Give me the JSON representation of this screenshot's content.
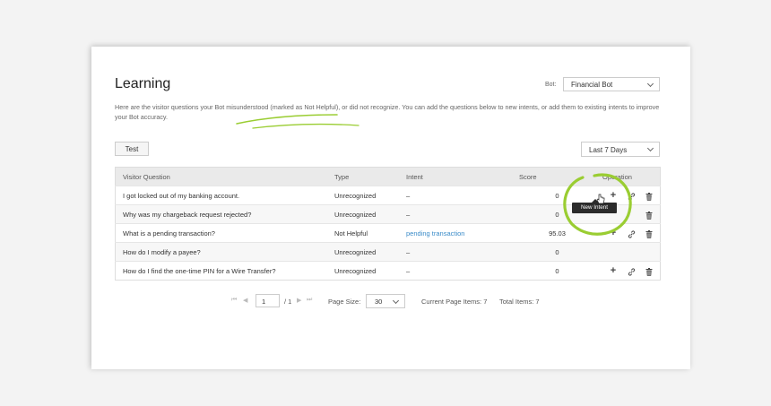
{
  "page": {
    "title": "Learning",
    "bot_label": "Bot:",
    "bot_value": "Financial Bot",
    "description": "Here are the visitor questions your Bot misunderstood (marked as Not Helpful), or did not recognize. You can add the questions below to new intents, or add them to existing intents to improve your Bot accuracy.",
    "test_label": "Test",
    "range_value": "Last 7 Days"
  },
  "table": {
    "headers": {
      "question": "Visitor Question",
      "type": "Type",
      "intent": "Intent",
      "score": "Score",
      "operation": "Operation"
    },
    "rows": [
      {
        "question": "I got locked out of my banking account.",
        "type": "Unrecognized",
        "intent": "–",
        "score": "0"
      },
      {
        "question": "Why was my chargeback request rejected?",
        "type": "Unrecognized",
        "intent": "–",
        "score": "0"
      },
      {
        "question": "What is a pending transaction?",
        "type": "Not Helpful",
        "intent": "pending transaction",
        "score": "95.03"
      },
      {
        "question": "How do I modify a payee?",
        "type": "Unrecognized",
        "intent": "–",
        "score": "0"
      },
      {
        "question": "How do I find the one-time PIN for a Wire Transfer?",
        "type": "Unrecognized",
        "intent": "–",
        "score": "0"
      }
    ]
  },
  "tooltip": "New Intent",
  "pager": {
    "page_value": "1",
    "page_total": "/ 1",
    "page_size_label": "Page Size:",
    "page_size_value": "30",
    "current_items": "Current Page Items: 7",
    "total_items": "Total Items: 7"
  },
  "icons": [
    "plus-icon",
    "link-icon",
    "trash-icon",
    "caret-down-icon",
    "first-page-icon",
    "prev-page-icon",
    "next-page-icon",
    "last-page-icon",
    "cursor-hand-icon"
  ],
  "colors": {
    "accent_highlight": "#9acd32",
    "link": "#3a8bc8",
    "tooltip_bg": "#2b2b2b",
    "header_bg": "#eaeaea"
  }
}
